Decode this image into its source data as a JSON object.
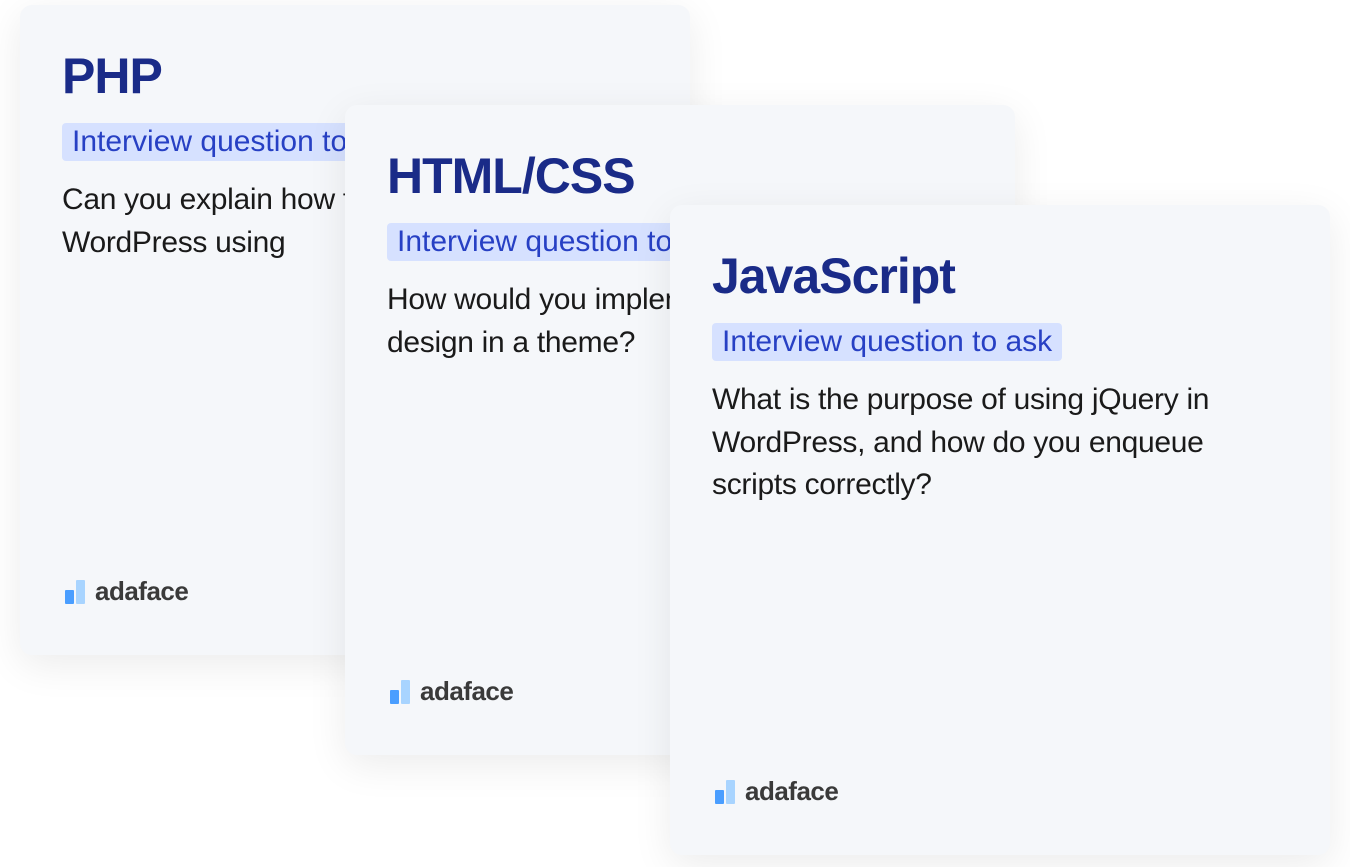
{
  "cards": [
    {
      "title": "PHP",
      "badge": "Interview question to ask",
      "question": "Can you explain how to create a custom WordPress using",
      "logo_text": "adaface"
    },
    {
      "title": "HTML/CSS",
      "badge": "Interview question to ask",
      "question": "How would you implement responsive design in a theme?",
      "logo_text": "adaface"
    },
    {
      "title": "JavaScript",
      "badge": "Interview question to ask",
      "question": "What is the purpose of using jQuery in WordPress, and how do you enqueue scripts correctly?",
      "logo_text": "adaface"
    }
  ]
}
